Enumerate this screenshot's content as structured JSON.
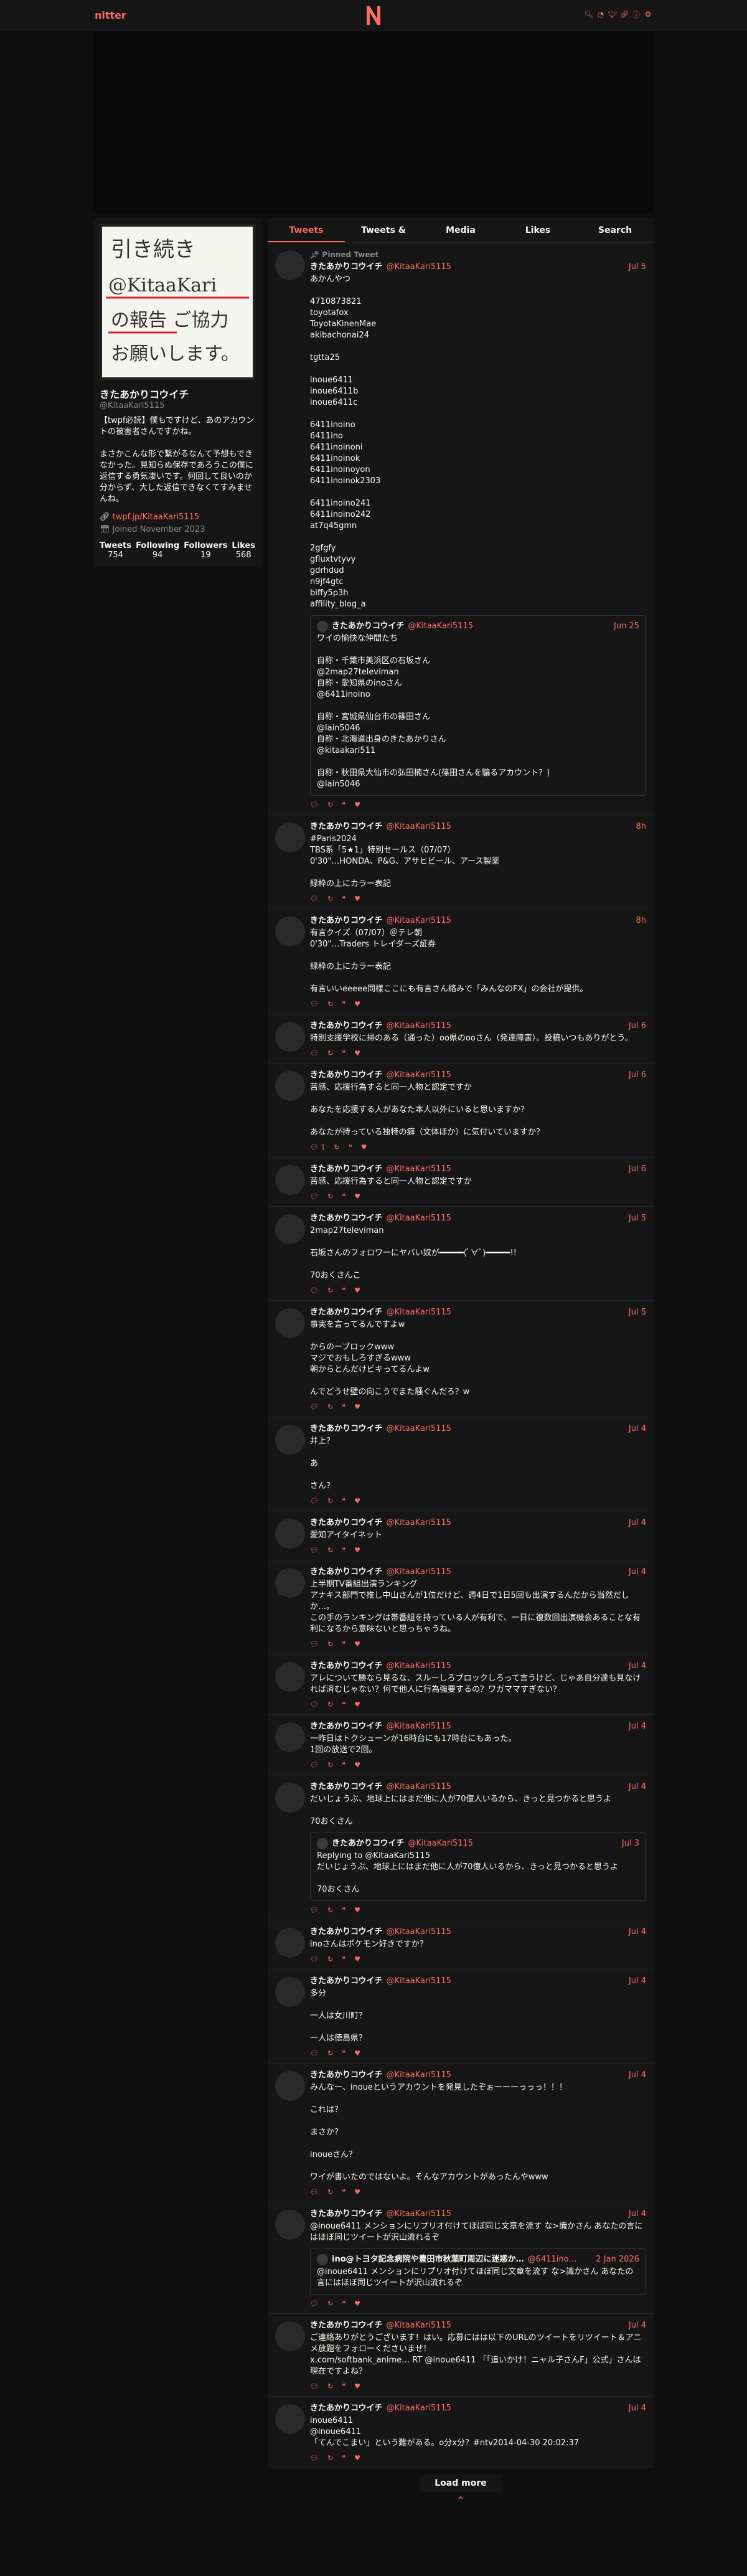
{
  "nav": {
    "brand": "nitter",
    "icons": [
      "search-icon",
      "rss-icon",
      "twitter-icon",
      "link-icon",
      "info-icon",
      "gear-icon"
    ]
  },
  "colors": {
    "accent": "#ff6c60",
    "bg": "#0f0f0f",
    "panel": "#161616"
  },
  "profile": {
    "avatar_lines": [
      "引き続き",
      "@KitaaKari",
      "の報告 ご協力",
      "お願いします。"
    ],
    "name": "きたあかりコウイチ",
    "username": "@KitaaKari5115",
    "bio": "【twpf必読】僕もですけど、あのアカウントの被害者さんですかね。\n\nまさかこんな形で繋がるなんて予想もできなかった。見知らぬ保存であろうこの僕に返信する勇気凄いです。何回して良いのか分からず、大した返信できなくてすみませんね。",
    "link": "twpf.jp/KitaaKari5115",
    "joined": "Joined November 2023",
    "stats": [
      {
        "label": "Tweets",
        "value": "754"
      },
      {
        "label": "Following",
        "value": "94"
      },
      {
        "label": "Followers",
        "value": "19"
      },
      {
        "label": "Likes",
        "value": "568"
      }
    ]
  },
  "tabs": [
    "Tweets",
    "Tweets & Replies",
    "Media",
    "Likes",
    "Search"
  ],
  "tweets": [
    {
      "pinned": "Pinned Tweet",
      "name": "きたあかりコウイチ",
      "user": "@KitaaKari5115",
      "date": "Jul 5",
      "body": "あかんやつ\n\n4710873821\ntoyotafox\nToyotaKinenMae\nakibachonai24\n\ntgtta25\n\ninoue6411\ninoue6411b\ninoue6411c\n\n6411inoino\n6411ino\n6411inoinoni\n6411inoinok\n6411inoinoyon\n6411inoinok2303\n\n6411inoino241\n6411inoino242\nat7q45gmn\n\n2gfgfy\ngfluxtvtyvy\ngdrhdud\nn9jf4gtc\nbiffy5p3h\naffility_blog_a",
      "quote": {
        "name": "きたあかりコウイチ",
        "user": "@KitaaKari5115",
        "date": "Jun 25",
        "body": "ワイの愉快な仲間たち\n\n自称・千葉市美浜区の石坂さん\n@2map27televiman\n自称・愛知県のinoさん\n@6411inoino\n\n自称・宮城県仙台市の篠田さん\n@lain5046\n自称・北海道出身のきたあかりさん\n@kitaakari511\n\n自称・秋田県大仙市の弘田楠さん(篠田さんを騙るアカウント？)\n@lain5046"
      },
      "stats": [
        "",
        "",
        "",
        ""
      ]
    },
    {
      "name": "きたあかりコウイチ",
      "user": "@KitaaKari5115",
      "date": "8h",
      "body": "#Paris2024\nTBS系「5★1」特別セールス（07/07）\n0'30\"…HONDA、P&G、アサヒビール、アース製薬\n\n緑枠の上にカラー表記",
      "stats": [
        "",
        "",
        "",
        ""
      ]
    },
    {
      "name": "きたあかりコウイチ",
      "user": "@KitaaKari5115",
      "date": "8h",
      "body": "有言クイズ（07/07）＠テレ朝\n0'30\"…Traders トレイダーズ証券\n\n緑枠の上にカラー表記\n\n有言いいeeeee同様ここにも有言さん絡みで「みんなのFX」の会社が提供。",
      "stats": [
        "",
        "",
        "",
        ""
      ]
    },
    {
      "name": "きたあかりコウイチ",
      "user": "@KitaaKari5115",
      "date": "Jul 6",
      "body": "特別支援学校に掃のある（通った）oo県のooさん（発達障害）。投稿いつもありがとう。",
      "stats": [
        "",
        "",
        "",
        ""
      ]
    },
    {
      "name": "きたあかりコウイチ",
      "user": "@KitaaKari5115",
      "date": "Jul 6",
      "body": "苦感、応援行為すると同一人物と認定ですか\n\nあなたを応援する人があなた本人以外にいると思いますか？\n\nあなたが持っている独特の癖（文体ほか）に気付いていますか？",
      "stats": [
        "1",
        "",
        "",
        ""
      ]
    },
    {
      "name": "きたあかりコウイチ",
      "user": "@KitaaKari5115",
      "date": "Jul 6",
      "body": "苦感、応援行為すると同一人物と認定ですか",
      "stats": [
        "",
        "",
        "",
        ""
      ]
    },
    {
      "name": "きたあかりコウイチ",
      "user": "@KitaaKari5115",
      "date": "Jul 5",
      "body": "2map27televiman\n\n石坂さんのフォロワーにヤバい奴が━━━━━(ﾟ∀ﾟ)━━━━━!!\n\n70おくさんこ",
      "stats": [
        "",
        "",
        "",
        ""
      ]
    },
    {
      "name": "きたあかりコウイチ",
      "user": "@KitaaKari5115",
      "date": "Jul 5",
      "body": "事実を言ってるんですよw\n\nからのーブロックwww\nマジでおもしろすぎるwww\n朝からとんだけビキってるんよw\n\nんでどうせ壁の向こうでまた騒ぐんだろ？w",
      "stats": [
        "",
        "",
        "",
        ""
      ]
    },
    {
      "name": "きたあかりコウイチ",
      "user": "@KitaaKari5115",
      "date": "Jul 4",
      "body": "井上？\n\nあ\n\nさん？",
      "stats": [
        "",
        "",
        "",
        ""
      ]
    },
    {
      "name": "きたあかりコウイチ",
      "user": "@KitaaKari5115",
      "date": "Jul 4",
      "body": "愛知アイタイネット",
      "stats": [
        "",
        "",
        "",
        ""
      ]
    },
    {
      "name": "きたあかりコウイチ",
      "user": "@KitaaKari5115",
      "date": "Jul 4",
      "body": "上半期TV番組出演ランキング\nアナキス部門で推し中山さんが1位だけど、週4日で1日5回も出演するんだから当然だしか…。\nこの手のランキングは帯番組を持っている人が有利で、一日に複数回出演機会あることな有利になるから意味ないと思っちゃうね。",
      "stats": [
        "",
        "",
        "",
        ""
      ]
    },
    {
      "name": "きたあかりコウイチ",
      "user": "@KitaaKari5115",
      "date": "Jul 4",
      "body": "アレについて勝なら見るな、スルーしろブロックしろって言うけど、じゃあ自分達も見なければ済むじゃない？何で他人に行為強要するの？ワガママすぎない？",
      "stats": [
        "",
        "",
        "",
        ""
      ]
    },
    {
      "name": "きたあかりコウイチ",
      "user": "@KitaaKari5115",
      "date": "Jul 4",
      "body": "一昨日はトクシューンが16時台にも17時台にもあった。\n1回の放送で2回。",
      "stats": [
        "",
        "",
        "",
        ""
      ]
    },
    {
      "name": "きたあかりコウイチ",
      "user": "@KitaaKari5115",
      "date": "Jul 4",
      "body": "だいじょうぶ、地球上にはまだ他に人が70億人いるから、きっと見つかると思うよ\n\n70おくさん",
      "quote": {
        "name": "きたあかりコウイチ",
        "user": "@KitaaKari5115",
        "date": "Jul 3",
        "body": "Replying to @KitaaKari5115\nだいじょうぶ、地球上にはまだ他に人が70億人いるから、きっと見つかると思うよ\n\n70おくさん"
      },
      "stats": [
        "",
        "",
        "",
        ""
      ]
    },
    {
      "name": "きたあかりコウイチ",
      "user": "@KitaaKari5115",
      "date": "Jul 4",
      "body": "inoさんはポケモン好きですか？",
      "stats": [
        "",
        "",
        "",
        ""
      ]
    },
    {
      "name": "きたあかりコウイチ",
      "user": "@KitaaKari5115",
      "date": "Jul 4",
      "body": "多分\n\n一人は女川町？\n\n一人は徳島県？",
      "stats": [
        "",
        "",
        "",
        ""
      ]
    },
    {
      "name": "きたあかりコウイチ",
      "user": "@KitaaKari5115",
      "date": "Jul 4",
      "body": "みんなー、inoueというアカウントを発見したぞぉーーーっっっ！！！\n\nこれは？\n\nまさか？\n\ninoueさん？\n\nワイが書いたのではないよ。そんなアカウントがあったんやwww",
      "stats": [
        "",
        "",
        "",
        ""
      ]
    },
    {
      "name": "きたあかりコウイチ",
      "user": "@KitaaKari5115",
      "date": "Jul 4",
      "body": "@inoue6411 メンションにリプリオ付けてほぼ同じ文章を流す な>識かさん あなたの言にはほぼ同じツイートが沢山流れるぞ",
      "quote": {
        "name": "ino@トヨタ記念病院や豊田市秋葉町周辺に迷惑か…",
        "user": "@6411ino…",
        "date": "2 Jan 2026",
        "body": "@inoue6411 メンションにリプリオ付けてほぼ同じ文章を流す な>識かさん あなたの言にはほぼ同じツイートが沢山流れるぞ"
      },
      "stats": [
        "",
        "",
        "",
        ""
      ]
    },
    {
      "name": "きたあかりコウイチ",
      "user": "@KitaaKari5115",
      "date": "Jul 4",
      "body": "ご連絡ありがとうございます！はい。応募にはは以下のURLのツイートをリツイート＆アニメ放題をフォローくださいませ！\nx.com/softbank_anime… RT @inoue6411 「「追いかけ！ニャル子さんF」公式」さんは現在ですよね？",
      "stats": [
        "",
        "",
        "",
        ""
      ]
    },
    {
      "name": "きたあかりコウイチ",
      "user": "@KitaaKari5115",
      "date": "Jul 4",
      "body": "inoue6411\n@inoue6411\n「てんでこまい」という難がある。o分x分？#ntv2014-04-30 20:02:37",
      "stats": [
        "",
        "",
        "",
        ""
      ]
    }
  ],
  "load_more": "Load more"
}
